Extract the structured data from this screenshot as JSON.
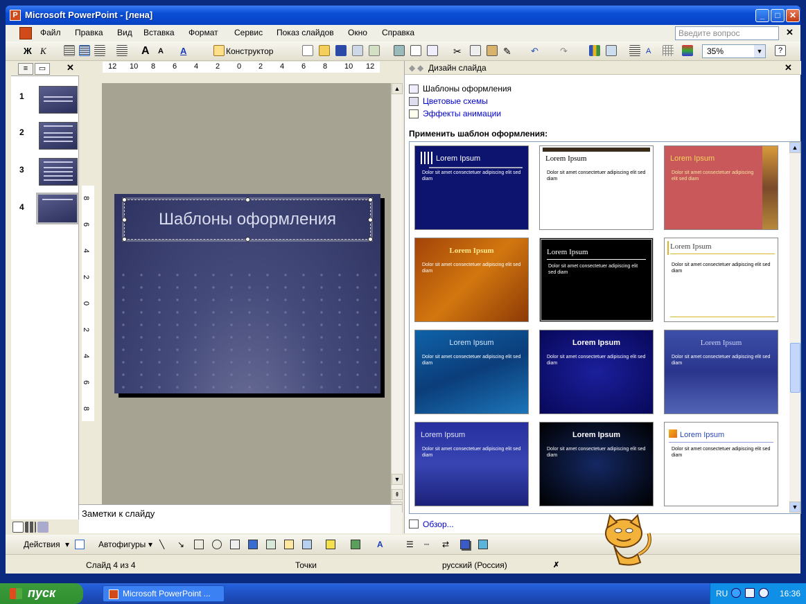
{
  "window": {
    "title": "Microsoft PowerPoint - [лена]"
  },
  "menu": {
    "items": [
      "Файл",
      "Правка",
      "Вид",
      "Вставка",
      "Формат",
      "Сервис",
      "Показ слайдов",
      "Окно",
      "Справка"
    ],
    "help_placeholder": "Введите вопрос"
  },
  "toolbar": {
    "bold": "Ж",
    "italic": "К",
    "designer": "Конструктор",
    "zoom": "35%"
  },
  "ruler": {
    "h_ticks": [
      "12",
      "10",
      "8",
      "6",
      "4",
      "2",
      "0",
      "2",
      "4",
      "6",
      "8",
      "10",
      "12"
    ],
    "v_ticks": [
      "8",
      "6",
      "4",
      "2",
      "0",
      "2",
      "4",
      "6",
      "8"
    ]
  },
  "slides": [
    {
      "num": "1",
      "selected": false
    },
    {
      "num": "2",
      "selected": false
    },
    {
      "num": "3",
      "selected": false
    },
    {
      "num": "4",
      "selected": true
    }
  ],
  "slide": {
    "title": "Шаблоны оформления"
  },
  "notes": {
    "label": "Заметки к слайду"
  },
  "task_pane": {
    "title": "Дизайн слайда",
    "links": [
      "Шаблоны оформления",
      "Цветовые схемы",
      "Эффекты анимации"
    ],
    "apply_label": "Применить шаблон оформления:",
    "browse": "Обзор...",
    "templates": [
      {
        "title": "Lorem Ipsum",
        "body": "Dolor sit amet consectetuer adipiscing elit sed diam"
      },
      {
        "title": "Lorem Ipsum",
        "body": "Dolor sit amet consectetuer adipiscing elit sed diam"
      },
      {
        "title": "Lorem Ipsum",
        "body": "Dolor sit amet consectetuer adipiscing elit sed diam"
      },
      {
        "title": "Lorem Ipsum",
        "body": "Dolor sit amet consectetuer adipiscing elit sed diam"
      },
      {
        "title": "Lorem Ipsum",
        "body": "Dolor sit amet consectetuer adipiscing elit sed diam"
      },
      {
        "title": "Lorem Ipsum",
        "body": "Dolor sit amet consectetuer adipiscing elit sed diam"
      },
      {
        "title": "Lorem Ipsum",
        "body": "Dolor sit amet consectetuer adipiscing elit sed diam"
      },
      {
        "title": "Lorem Ipsum",
        "body": "Dolor sit amet consectetuer adipiscing elit sed diam"
      },
      {
        "title": "Lorem Ipsum",
        "body": "Dolor sit amet consectetuer adipiscing elit sed diam"
      },
      {
        "title": "Lorem Ipsum",
        "body": "Dolor sit amet consectetuer adipiscing elit sed diam"
      },
      {
        "title": "Lorem Ipsum",
        "body": "Dolor sit amet consectetuer adipiscing elit sed diam"
      },
      {
        "title": "Lorem Ipsum",
        "body": "Dolor sit amet consectetuer adipiscing elit sed diam"
      }
    ]
  },
  "drawbar": {
    "actions": "Действия",
    "autoshapes": "Автофигуры"
  },
  "status": {
    "slide": "Слайд 4 из 4",
    "design": "Точки",
    "language": "русский (Россия)"
  },
  "taskbar": {
    "start": "пуск",
    "task_item": "Microsoft PowerPoint ...",
    "lang": "RU",
    "clock": "16:36"
  }
}
